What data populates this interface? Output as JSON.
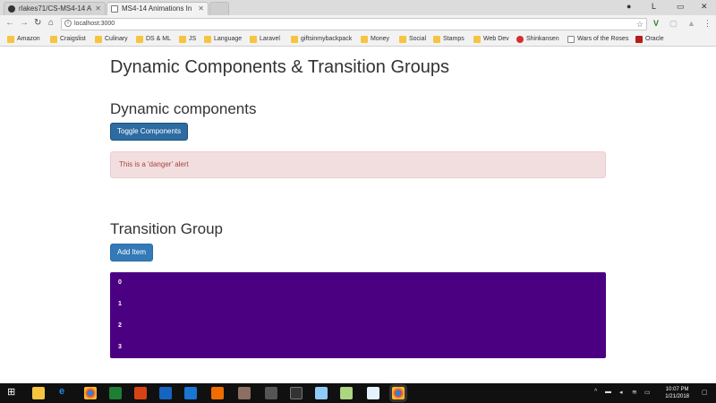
{
  "browser": {
    "tabs": [
      {
        "label": "rlakes71/CS-MS4-14 A"
      },
      {
        "label": "MS4-14 Animations In"
      },
      {
        "label": ""
      }
    ],
    "address": "localhost:3000",
    "bookmarks": [
      {
        "label": "Amazon",
        "icon": "folder-icon"
      },
      {
        "label": "Craigslist",
        "icon": "folder-icon"
      },
      {
        "label": "Culinary",
        "icon": "folder-icon"
      },
      {
        "label": "DS & ML",
        "icon": "folder-icon"
      },
      {
        "label": "JS",
        "icon": "folder-icon"
      },
      {
        "label": "Language",
        "icon": "folder-icon"
      },
      {
        "label": "Laravel",
        "icon": "folder-icon"
      },
      {
        "label": "giftsinmybackpack",
        "icon": "folder-icon"
      },
      {
        "label": "Money",
        "icon": "folder-icon"
      },
      {
        "label": "Social",
        "icon": "folder-icon"
      },
      {
        "label": "Stamps",
        "icon": "folder-icon"
      },
      {
        "label": "Web Dev",
        "icon": "folder-icon"
      },
      {
        "label": "Shinkansen",
        "icon": "bookmark-icon"
      },
      {
        "label": "Wars of the Roses",
        "icon": "page-icon"
      },
      {
        "label": "Oracle",
        "icon": "oracle-icon"
      }
    ]
  },
  "page": {
    "title": "Dynamic Components & Transition Groups",
    "dynamic": {
      "heading": "Dynamic components",
      "button": "Toggle Components",
      "alert": "This is a 'danger' alert"
    },
    "transition": {
      "heading": "Transition Group",
      "button": "Add Item",
      "items": [
        "0",
        "1",
        "2",
        "3"
      ],
      "list_color": "#4b0082"
    }
  },
  "taskbar": {
    "time": "10:07 PM",
    "date": "1/21/2018"
  }
}
